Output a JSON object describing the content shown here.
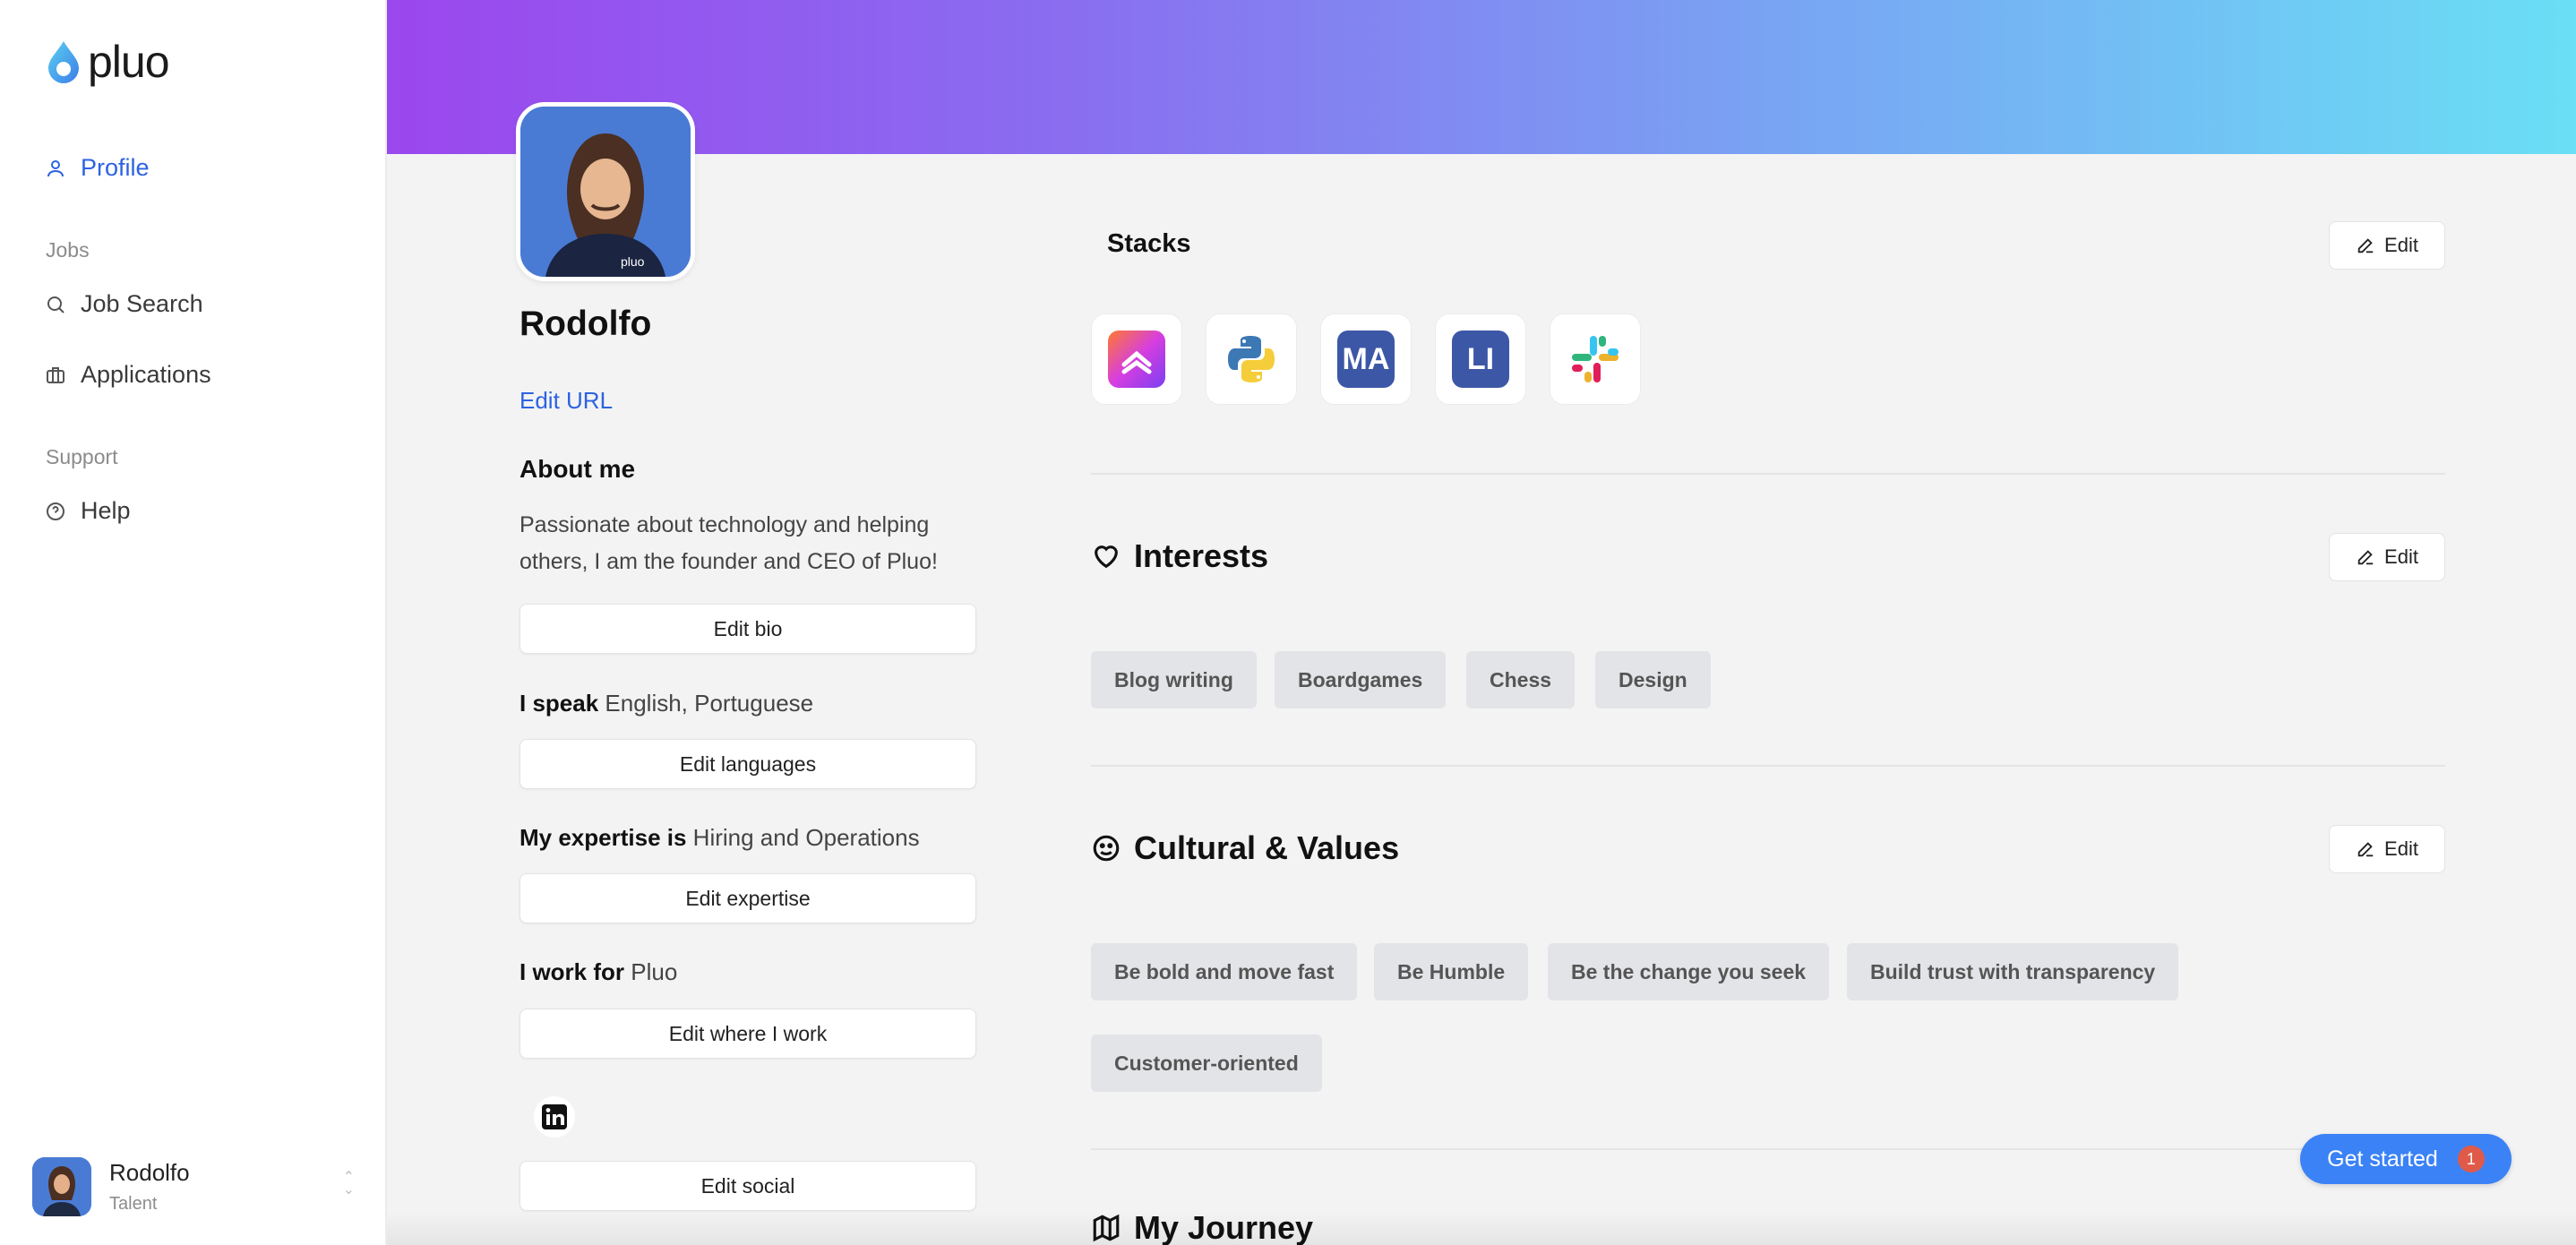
{
  "brand": {
    "name": "pluo"
  },
  "sidebar": {
    "profile": "Profile",
    "jobs_section": "Jobs",
    "job_search": "Job Search",
    "applications": "Applications",
    "support_section": "Support",
    "help": "Help"
  },
  "user": {
    "name": "Rodolfo",
    "role": "Talent"
  },
  "profile": {
    "name": "Rodolfo",
    "edit_url": "Edit URL",
    "about_title": "About me",
    "about_text": "Passionate about technology and helping others, I am the founder and CEO of Pluo!",
    "edit_bio": "Edit bio",
    "speak_label": "I speak",
    "speak_value": "English, Portuguese",
    "edit_languages": "Edit languages",
    "expertise_label": "My expertise is",
    "expertise_value": "Hiring and Operations",
    "edit_expertise": "Edit expertise",
    "work_label": "I work for",
    "work_value": "Pluo",
    "edit_work": "Edit where I work",
    "edit_social": "Edit social"
  },
  "stacks": {
    "title": "Stacks",
    "edit": "Edit",
    "items": [
      {
        "icon": "clickup-icon"
      },
      {
        "icon": "python-icon"
      },
      {
        "letters": "MA"
      },
      {
        "letters": "LI"
      },
      {
        "icon": "slack-icon"
      }
    ]
  },
  "interests": {
    "title": "Interests",
    "edit": "Edit",
    "chips": [
      "Blog writing",
      "Boardgames",
      "Chess",
      "Design"
    ]
  },
  "culture": {
    "title": "Cultural & Values",
    "edit": "Edit",
    "chips": [
      "Be bold and move fast",
      "Be Humble",
      "Be the change you seek",
      "Build trust with transparency",
      "Customer-oriented"
    ]
  },
  "journey": {
    "title": "My Journey"
  },
  "cta": {
    "label": "Get started",
    "badge": "1"
  },
  "colors": {
    "accent": "#2d63e0",
    "cta": "#3b82f6",
    "badge": "#e05a4a"
  }
}
